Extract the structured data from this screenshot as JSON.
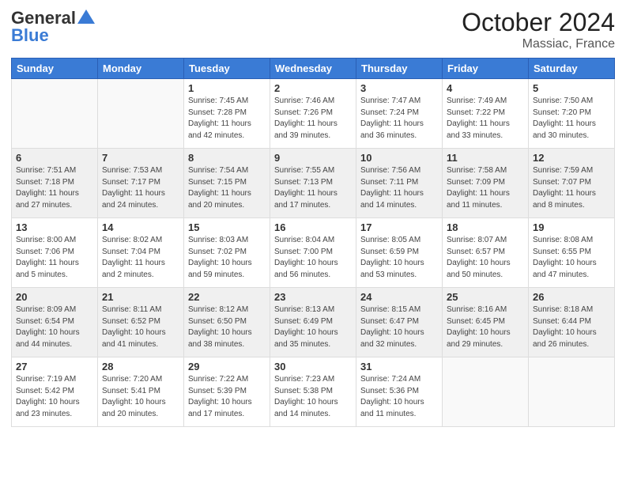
{
  "header": {
    "logo_general": "General",
    "logo_blue": "Blue",
    "month": "October 2024",
    "location": "Massiac, France"
  },
  "days_of_week": [
    "Sunday",
    "Monday",
    "Tuesday",
    "Wednesday",
    "Thursday",
    "Friday",
    "Saturday"
  ],
  "weeks": [
    [
      {
        "day": "",
        "info": ""
      },
      {
        "day": "",
        "info": ""
      },
      {
        "day": "1",
        "info": "Sunrise: 7:45 AM\nSunset: 7:28 PM\nDaylight: 11 hours and 42 minutes."
      },
      {
        "day": "2",
        "info": "Sunrise: 7:46 AM\nSunset: 7:26 PM\nDaylight: 11 hours and 39 minutes."
      },
      {
        "day": "3",
        "info": "Sunrise: 7:47 AM\nSunset: 7:24 PM\nDaylight: 11 hours and 36 minutes."
      },
      {
        "day": "4",
        "info": "Sunrise: 7:49 AM\nSunset: 7:22 PM\nDaylight: 11 hours and 33 minutes."
      },
      {
        "day": "5",
        "info": "Sunrise: 7:50 AM\nSunset: 7:20 PM\nDaylight: 11 hours and 30 minutes."
      }
    ],
    [
      {
        "day": "6",
        "info": "Sunrise: 7:51 AM\nSunset: 7:18 PM\nDaylight: 11 hours and 27 minutes."
      },
      {
        "day": "7",
        "info": "Sunrise: 7:53 AM\nSunset: 7:17 PM\nDaylight: 11 hours and 24 minutes."
      },
      {
        "day": "8",
        "info": "Sunrise: 7:54 AM\nSunset: 7:15 PM\nDaylight: 11 hours and 20 minutes."
      },
      {
        "day": "9",
        "info": "Sunrise: 7:55 AM\nSunset: 7:13 PM\nDaylight: 11 hours and 17 minutes."
      },
      {
        "day": "10",
        "info": "Sunrise: 7:56 AM\nSunset: 7:11 PM\nDaylight: 11 hours and 14 minutes."
      },
      {
        "day": "11",
        "info": "Sunrise: 7:58 AM\nSunset: 7:09 PM\nDaylight: 11 hours and 11 minutes."
      },
      {
        "day": "12",
        "info": "Sunrise: 7:59 AM\nSunset: 7:07 PM\nDaylight: 11 hours and 8 minutes."
      }
    ],
    [
      {
        "day": "13",
        "info": "Sunrise: 8:00 AM\nSunset: 7:06 PM\nDaylight: 11 hours and 5 minutes."
      },
      {
        "day": "14",
        "info": "Sunrise: 8:02 AM\nSunset: 7:04 PM\nDaylight: 11 hours and 2 minutes."
      },
      {
        "day": "15",
        "info": "Sunrise: 8:03 AM\nSunset: 7:02 PM\nDaylight: 10 hours and 59 minutes."
      },
      {
        "day": "16",
        "info": "Sunrise: 8:04 AM\nSunset: 7:00 PM\nDaylight: 10 hours and 56 minutes."
      },
      {
        "day": "17",
        "info": "Sunrise: 8:05 AM\nSunset: 6:59 PM\nDaylight: 10 hours and 53 minutes."
      },
      {
        "day": "18",
        "info": "Sunrise: 8:07 AM\nSunset: 6:57 PM\nDaylight: 10 hours and 50 minutes."
      },
      {
        "day": "19",
        "info": "Sunrise: 8:08 AM\nSunset: 6:55 PM\nDaylight: 10 hours and 47 minutes."
      }
    ],
    [
      {
        "day": "20",
        "info": "Sunrise: 8:09 AM\nSunset: 6:54 PM\nDaylight: 10 hours and 44 minutes."
      },
      {
        "day": "21",
        "info": "Sunrise: 8:11 AM\nSunset: 6:52 PM\nDaylight: 10 hours and 41 minutes."
      },
      {
        "day": "22",
        "info": "Sunrise: 8:12 AM\nSunset: 6:50 PM\nDaylight: 10 hours and 38 minutes."
      },
      {
        "day": "23",
        "info": "Sunrise: 8:13 AM\nSunset: 6:49 PM\nDaylight: 10 hours and 35 minutes."
      },
      {
        "day": "24",
        "info": "Sunrise: 8:15 AM\nSunset: 6:47 PM\nDaylight: 10 hours and 32 minutes."
      },
      {
        "day": "25",
        "info": "Sunrise: 8:16 AM\nSunset: 6:45 PM\nDaylight: 10 hours and 29 minutes."
      },
      {
        "day": "26",
        "info": "Sunrise: 8:18 AM\nSunset: 6:44 PM\nDaylight: 10 hours and 26 minutes."
      }
    ],
    [
      {
        "day": "27",
        "info": "Sunrise: 7:19 AM\nSunset: 5:42 PM\nDaylight: 10 hours and 23 minutes."
      },
      {
        "day": "28",
        "info": "Sunrise: 7:20 AM\nSunset: 5:41 PM\nDaylight: 10 hours and 20 minutes."
      },
      {
        "day": "29",
        "info": "Sunrise: 7:22 AM\nSunset: 5:39 PM\nDaylight: 10 hours and 17 minutes."
      },
      {
        "day": "30",
        "info": "Sunrise: 7:23 AM\nSunset: 5:38 PM\nDaylight: 10 hours and 14 minutes."
      },
      {
        "day": "31",
        "info": "Sunrise: 7:24 AM\nSunset: 5:36 PM\nDaylight: 10 hours and 11 minutes."
      },
      {
        "day": "",
        "info": ""
      },
      {
        "day": "",
        "info": ""
      }
    ]
  ]
}
